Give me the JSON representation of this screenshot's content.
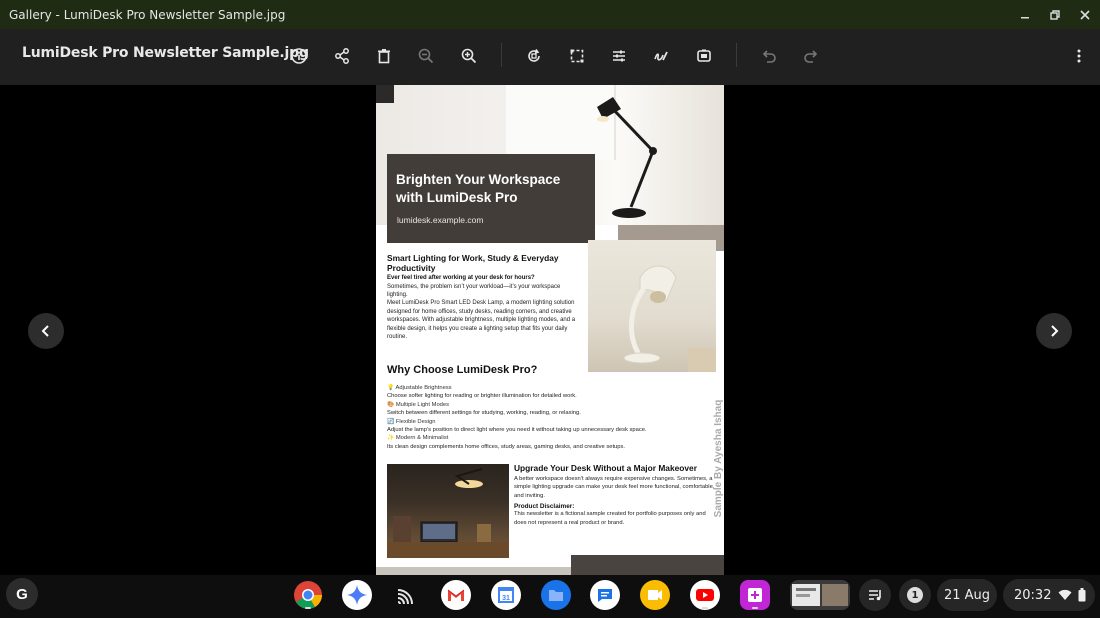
{
  "window": {
    "title": "Gallery - LumiDesk Pro Newsletter Sample.jpg",
    "controls": [
      "minimize-icon",
      "restore-icon",
      "close-icon"
    ]
  },
  "toolbar": {
    "file_name": "LumiDesk Pro Newsletter Sample.jpg",
    "actions": [
      "info-icon",
      "share-icon",
      "delete-icon",
      "zoom-out-icon",
      "zoom-in-icon",
      "rotate-icon",
      "crop-icon",
      "adjust-icon",
      "annotate-icon",
      "rescale-icon",
      "undo-icon",
      "redo-icon",
      "more-icon"
    ]
  },
  "newsletter": {
    "headline": "Brighten Your Workspace with LumiDesk Pro",
    "url": "lumidesk.example.com",
    "section1": {
      "heading": "Smart Lighting for Work, Study & Everyday Productivity",
      "lead": "Ever feel tired after working at your desk for hours?",
      "para1": "Sometimes, the problem isn’t your workload—it’s your workspace lighting.",
      "para2": "Meet LumiDesk Pro Smart LED Desk Lamp, a modern lighting solution designed for home offices, study desks, reading corners, and creative workspaces. With adjustable brightness, multiple lighting modes, and a flexible design, it helps you create a lighting setup that fits your daily routine."
    },
    "why": {
      "heading": "Why Choose LumiDesk Pro?",
      "features": [
        {
          "icon": "💡",
          "title": "Adjustable Brightness",
          "desc": "Choose softer lighting for reading or brighter illumination for detailed work."
        },
        {
          "icon": "🎨",
          "title": "Multiple Light Modes",
          "desc": "Switch between different settings for studying, working, reading, or relaxing."
        },
        {
          "icon": "🔄",
          "title": "Flexible Design",
          "desc": "Adjust the lamp’s position to direct light where you need it without taking up unnecessary desk space."
        },
        {
          "icon": "✨",
          "title": "Modern & Minimalist",
          "desc": "Its clean design complements home offices, study areas, gaming desks, and creative setups."
        }
      ]
    },
    "section3": {
      "heading": "Upgrade Your Desk Without a Major Makeover",
      "para": "A better workspace doesn’t always require expensive changes. Sometimes, a simple lighting upgrade can make your desk feel more functional, comfortable, and inviting.",
      "disclaimer_title": "Product Disclaimer:",
      "disclaimer": "This newsletter is a fictional sample created for portfolio purposes only and does not represent a real product or brand."
    },
    "watermark": "Sample By Ayesha Ishaq"
  },
  "shelf": {
    "launcher": "G",
    "apps": [
      "chrome-icon",
      "gemini-icon",
      "cast-icon",
      "gmail-icon",
      "calendar-icon",
      "files-icon",
      "messages-icon",
      "meet-icon",
      "youtube-icon",
      "gallery-icon",
      "window-preview-icon"
    ],
    "notification_count": "1",
    "date": "21 Aug",
    "time": "20:32"
  }
}
